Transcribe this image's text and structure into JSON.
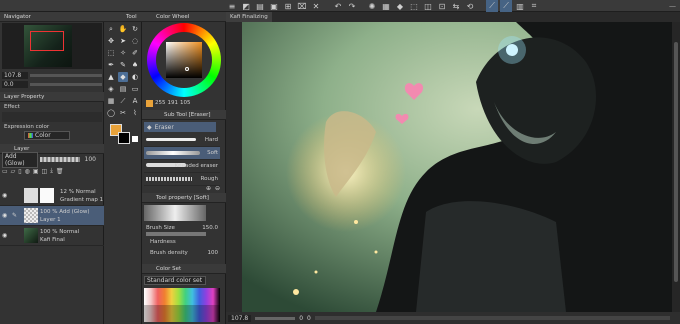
{
  "toolbar": {
    "icons": [
      "menu-icon",
      "undo-icon",
      "redo-icon",
      "spinner-icon",
      "select-all-icon",
      "deselect-icon",
      "clear-icon",
      "fill-icon",
      "transform-icon",
      "ruler-icon",
      "snap-icon",
      "snap-guide-icon",
      "snap-grid-icon",
      "perspective-icon"
    ]
  },
  "navigator": {
    "title": "Navigator",
    "zoom": "107.8",
    "angle": "0.0"
  },
  "tools_panel": {
    "title": "Tool"
  },
  "color_wheel": {
    "title": "Color Wheel",
    "h": "255",
    "s": "191",
    "v": "105",
    "main_color": "#e8a23a"
  },
  "sub_tool": {
    "title": "Sub Tool [Eraser]",
    "group": "Eraser",
    "brushes": [
      "Hard",
      "Soft",
      "Kneaded eraser",
      "Rough"
    ]
  },
  "tool_property": {
    "title": "Tool property [Soft]",
    "brush_size_label": "Brush Size",
    "brush_size": "150.0",
    "hardness_label": "Hardness",
    "brush_density_label": "Brush density",
    "brush_density": "100"
  },
  "color_set": {
    "title": "Color Set",
    "set_name": "Standard color set"
  },
  "layer_property": {
    "title": "Layer Property",
    "effect_label": "Effect",
    "expression_label": "Expression color",
    "expression_value": "Color"
  },
  "layer_panel": {
    "title": "Layer",
    "blend_mode": "Add (Glow)",
    "opacity": "100",
    "layers": [
      {
        "line1": "12 % Normal",
        "line2": "Gradient map 1",
        "selected": false
      },
      {
        "line1": "100 % Add (Glow)",
        "line2": "Layer 1",
        "selected": true
      },
      {
        "line1": "100 % Normal",
        "line2": "Kafi Final",
        "selected": false
      }
    ]
  },
  "canvas": {
    "tab_title": "Kafi Finalizing",
    "zoom": "107.8",
    "coord_x": "0",
    "coord_y": "0"
  }
}
